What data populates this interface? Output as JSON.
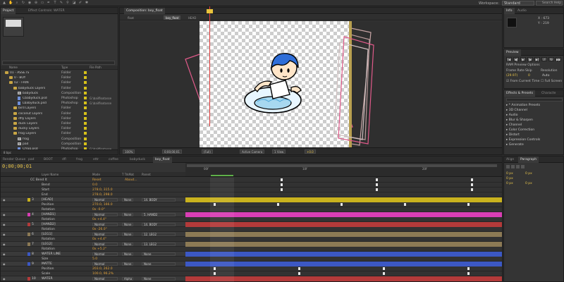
{
  "menu": {
    "workspace_label": "Workspace:",
    "workspace_value": "Standard",
    "search_placeholder": "Search Help"
  },
  "project": {
    "tabs": [
      "Project",
      "Effect Controls: WATER"
    ],
    "columns": [
      "Name",
      "Type",
      "File Path"
    ],
    "items": [
      {
        "name": "01 - ASSETS",
        "type": "Folder",
        "path": "",
        "kind": "folder",
        "indent": 0
      },
      {
        "name": "0 - BOY",
        "type": "Folder",
        "path": "",
        "kind": "folder",
        "indent": 1
      },
      {
        "name": "02 - FRIN",
        "type": "Folder",
        "path": "",
        "kind": "folder",
        "indent": 1
      },
      {
        "name": "babyduck Layers",
        "type": "Folder",
        "path": "",
        "kind": "folder",
        "indent": 2
      },
      {
        "name": "babyduck",
        "type": "Composition",
        "path": "",
        "kind": "comp",
        "indent": 3
      },
      {
        "name": "Cbabyduck.psd",
        "type": "Photoshop",
        "path": "G:\\bailfloatasse",
        "kind": "file",
        "indent": 3
      },
      {
        "name": "Lbabyduck.psd",
        "type": "Photoshop",
        "path": "G:\\bailfloatasse",
        "kind": "file",
        "indent": 3
      },
      {
        "name": "bird Layers",
        "type": "Folder",
        "path": "",
        "kind": "folder",
        "indent": 2
      },
      {
        "name": "coconut Layers",
        "type": "Folder",
        "path": "",
        "kind": "folder",
        "indent": 2
      },
      {
        "name": "dfly Layers",
        "type": "Folder",
        "path": "",
        "kind": "folder",
        "indent": 2
      },
      {
        "name": "duck Layers",
        "type": "Folder",
        "path": "",
        "kind": "folder",
        "indent": 2
      },
      {
        "name": "ducky Layers",
        "type": "Folder",
        "path": "",
        "kind": "folder",
        "indent": 2
      },
      {
        "name": "frog Layers",
        "type": "Folder",
        "path": "",
        "kind": "folder",
        "indent": 2
      },
      {
        "name": "frog",
        "type": "Composition",
        "path": "",
        "kind": "comp",
        "indent": 3
      },
      {
        "name": "pad",
        "type": "Composition",
        "path": "",
        "kind": "comp",
        "indent": 3
      },
      {
        "name": "Cfrog.psd",
        "type": "Photoshop",
        "path": "G:\\bailfloatasse",
        "kind": "file",
        "indent": 3
      }
    ],
    "footer": "8 bpc"
  },
  "comp": {
    "tab_title": "Composition: boy_float",
    "crumbs": [
      "float",
      "HEAD"
    ],
    "active_crumb": "boy_float",
    "zoom": "100%",
    "timecode": "0;00;00;01",
    "resolution": "(Full)",
    "camera": "Active Camera",
    "view": "1 View",
    "offset": "+0.0"
  },
  "info": {
    "tabs": [
      "Info",
      "Audio"
    ],
    "x": "X : 673",
    "y": "Y : 219"
  },
  "preview": {
    "title": "Preview",
    "options": "RAM Preview Options",
    "frame_rate": "Frame Rate",
    "skip": "Skip",
    "resolution": "Resolution",
    "fps": "(29.97)",
    "skip_val": "0",
    "res_val": "Auto",
    "from_current": "From Current Time",
    "full_screen": "Full Screen"
  },
  "effects": {
    "tabs": [
      "Effects & Presets",
      "Characte"
    ],
    "items": [
      "* Animation Presets",
      "3D Channel",
      "Audio",
      "Blur & Sharpen",
      "Channel",
      "Color Correction",
      "Distort",
      "Expression Controls",
      "Generate"
    ]
  },
  "align": {
    "tabs": [
      "Align",
      "Paragraph"
    ],
    "fields": [
      "0 px",
      "0 px",
      "0 px",
      "0 px",
      "0 px"
    ]
  },
  "timeline": {
    "tabs": [
      "Render Queue",
      "pad",
      "BOOT",
      "dfl",
      "frog",
      "ettr",
      "coffee",
      "babyduck",
      "boy_float"
    ],
    "time": "0;00;00;01",
    "col_headers": [
      "Layer Name",
      "Mode",
      "T TrkMat",
      "Parent"
    ],
    "ruler_marks": [
      "00f",
      "10f",
      "20f"
    ],
    "rows": [
      {
        "kind": "prop",
        "name": "CC Bend It",
        "value": "Reset",
        "value2": "About...",
        "indent": 42
      },
      {
        "kind": "prop",
        "name": "Bend",
        "value": "0.0",
        "indent": 58
      },
      {
        "kind": "prop",
        "name": "Start",
        "value": "278.0, 315.0",
        "indent": 58
      },
      {
        "kind": "prop",
        "name": "End",
        "value": "278.0, 298.0",
        "indent": 58
      },
      {
        "kind": "layer",
        "num": "3",
        "name": "[HEAD]",
        "mode": "Normal",
        "trk": "None",
        "parent": "14. BODY",
        "color": "#c9b21e"
      },
      {
        "kind": "prop",
        "name": "Position",
        "value": "270.0, 166.0",
        "indent": 58
      },
      {
        "kind": "prop",
        "name": "Rotation",
        "value": "0x -0.0°",
        "indent": 58
      },
      {
        "kind": "layer",
        "num": "4",
        "name": "[HAND1]",
        "mode": "Normal",
        "trk": "None",
        "parent": "5. HAND2",
        "color": "#d93eb4"
      },
      {
        "kind": "prop",
        "name": "Rotation",
        "value": "0x +4.4°",
        "indent": 58
      },
      {
        "kind": "layer",
        "num": "5",
        "name": "[HAND2]",
        "mode": "Normal",
        "trk": "None",
        "parent": "14. BODY",
        "color": "#b33a3a"
      },
      {
        "kind": "prop",
        "name": "Rotation",
        "value": "0x -26.0°",
        "indent": 58
      },
      {
        "kind": "layer",
        "num": "6",
        "name": "[LEG1]",
        "mode": "Normal",
        "trk": "None",
        "parent": "12. LEG2",
        "color": "#8c7a55"
      },
      {
        "kind": "prop",
        "name": "Rotation",
        "value": "0x +4.4°",
        "indent": 58
      },
      {
        "kind": "layer",
        "num": "7",
        "name": "[LEG2]",
        "mode": "Normal",
        "trk": "None",
        "parent": "13. LEG2",
        "color": "#8c7a55"
      },
      {
        "kind": "prop",
        "name": "Rotation",
        "value": "0x +5.2°",
        "indent": 58
      },
      {
        "kind": "layer",
        "num": "8",
        "name": "WATER LINE",
        "mode": "Normal",
        "trk": "None",
        "parent": "None",
        "color": "#3c58c4"
      },
      {
        "kind": "prop",
        "name": "Size",
        "value": "5.0",
        "indent": 58
      },
      {
        "kind": "layer",
        "num": "9",
        "name": "MATTE",
        "mode": "Normal",
        "trk": "None",
        "parent": "None",
        "color": "#3c58c4"
      },
      {
        "kind": "prop",
        "name": "Position",
        "value": "203.0, 262.0",
        "indent": 58
      },
      {
        "kind": "prop",
        "name": "Scale",
        "value": "100.0, 96.2%",
        "indent": 58
      },
      {
        "kind": "layer",
        "num": "10",
        "name": "WATER",
        "mode": "Normal",
        "trk": "Alpha",
        "parent": "None",
        "color": "#b33a3a"
      }
    ]
  }
}
